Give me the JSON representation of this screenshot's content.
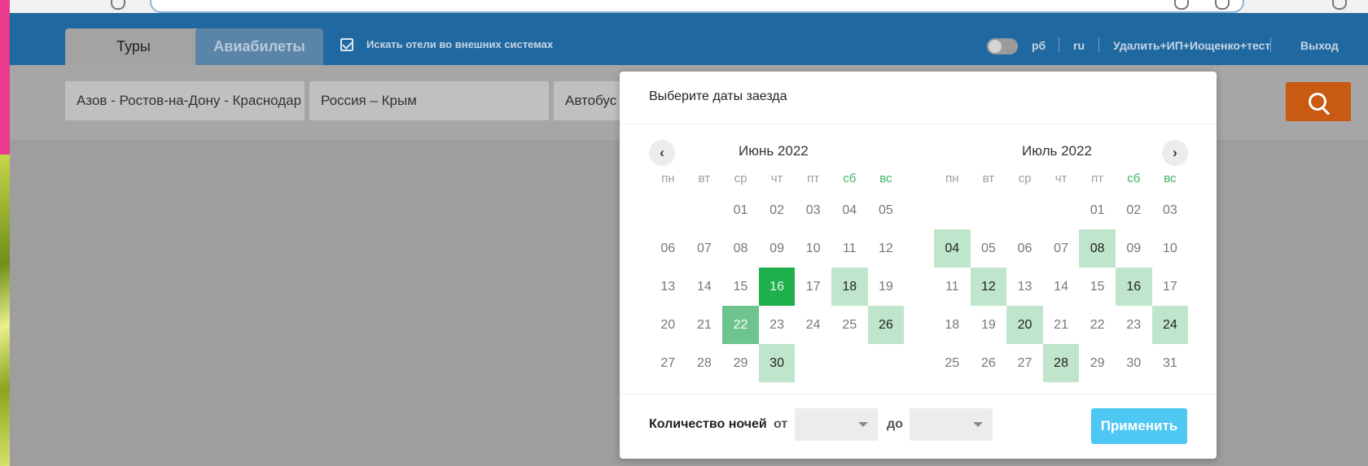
{
  "header": {
    "tabs": [
      {
        "label": "Туры",
        "active": true
      },
      {
        "label": "Авиабилеты",
        "active": false
      }
    ],
    "external_search_label": "Искать отели во внешних системах",
    "external_search_checked": true,
    "links": [
      "рб",
      "ru",
      "Удалить+ИП+Иощенко+тест",
      "Выход"
    ]
  },
  "search": {
    "fields": [
      "Азов - Ростов-на-Дону - Краснодар",
      "Россия – Крым",
      "Автобус"
    ],
    "icon": "search-icon"
  },
  "picker": {
    "title": "Выберите даты заезда",
    "weekdays": [
      "пн",
      "вт",
      "ср",
      "чт",
      "пт",
      "сб",
      "вс"
    ],
    "months": [
      {
        "title": "Июнь 2022",
        "days": [
          {
            "d": "",
            "s": "empty"
          },
          {
            "d": "",
            "s": "empty"
          },
          {
            "d": "01"
          },
          {
            "d": "02"
          },
          {
            "d": "03"
          },
          {
            "d": "04"
          },
          {
            "d": "05"
          },
          {
            "d": "06"
          },
          {
            "d": "07"
          },
          {
            "d": "08"
          },
          {
            "d": "09"
          },
          {
            "d": "10"
          },
          {
            "d": "11"
          },
          {
            "d": "12"
          },
          {
            "d": "13"
          },
          {
            "d": "14"
          },
          {
            "d": "15"
          },
          {
            "d": "16",
            "s": "selected"
          },
          {
            "d": "17"
          },
          {
            "d": "18",
            "s": "avail"
          },
          {
            "d": "19"
          },
          {
            "d": "20"
          },
          {
            "d": "21"
          },
          {
            "d": "22",
            "s": "mid"
          },
          {
            "d": "23"
          },
          {
            "d": "24"
          },
          {
            "d": "25"
          },
          {
            "d": "26",
            "s": "avail"
          },
          {
            "d": "27"
          },
          {
            "d": "28"
          },
          {
            "d": "29"
          },
          {
            "d": "30",
            "s": "avail"
          }
        ]
      },
      {
        "title": "Июль 2022",
        "days": [
          {
            "d": "",
            "s": "empty"
          },
          {
            "d": "",
            "s": "empty"
          },
          {
            "d": "",
            "s": "empty"
          },
          {
            "d": "",
            "s": "empty"
          },
          {
            "d": "01"
          },
          {
            "d": "02"
          },
          {
            "d": "03"
          },
          {
            "d": "04",
            "s": "avail"
          },
          {
            "d": "05"
          },
          {
            "d": "06"
          },
          {
            "d": "07"
          },
          {
            "d": "08",
            "s": "avail"
          },
          {
            "d": "09"
          },
          {
            "d": "10"
          },
          {
            "d": "11"
          },
          {
            "d": "12",
            "s": "avail"
          },
          {
            "d": "13"
          },
          {
            "d": "14"
          },
          {
            "d": "15"
          },
          {
            "d": "16",
            "s": "avail"
          },
          {
            "d": "17"
          },
          {
            "d": "18"
          },
          {
            "d": "19"
          },
          {
            "d": "20",
            "s": "avail"
          },
          {
            "d": "21"
          },
          {
            "d": "22"
          },
          {
            "d": "23"
          },
          {
            "d": "24",
            "s": "avail"
          },
          {
            "d": "25"
          },
          {
            "d": "26"
          },
          {
            "d": "27"
          },
          {
            "d": "28",
            "s": "avail"
          },
          {
            "d": "29"
          },
          {
            "d": "30"
          },
          {
            "d": "31"
          }
        ]
      }
    ],
    "nights_label": "Количество ночей",
    "from_label": "от",
    "to_label": "до",
    "from_value": "",
    "to_value": "",
    "apply_label": "Применить"
  },
  "colors": {
    "header_bg": "#2068a0",
    "selected_day": "#1fb04e",
    "available_day": "#bfe6cc",
    "apply_button": "#4ec7f3",
    "search_button": "#c85a12"
  }
}
